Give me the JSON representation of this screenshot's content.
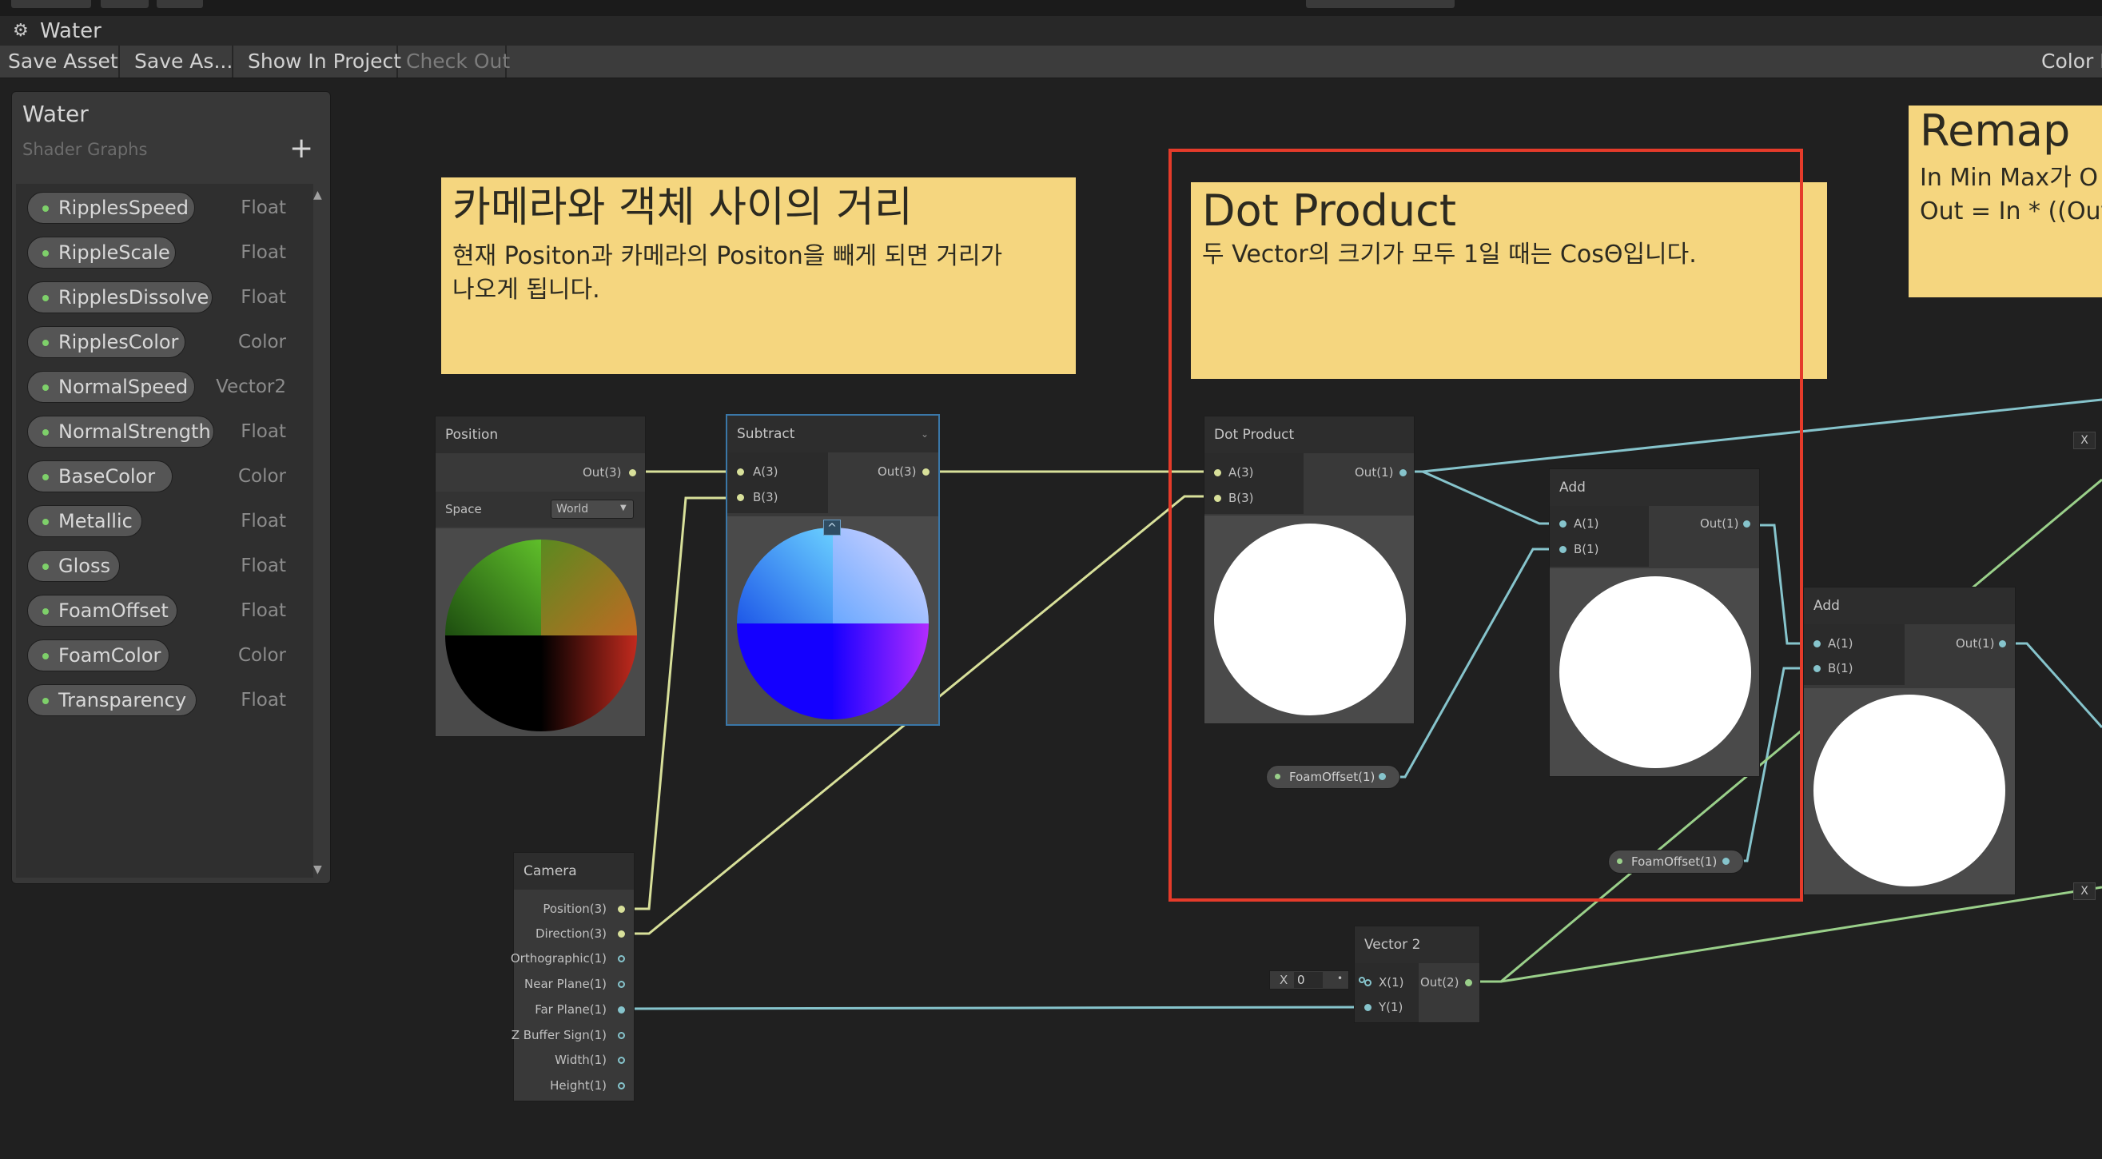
{
  "window": {
    "title": "Water"
  },
  "toolbar": {
    "save_asset": "Save Asset",
    "save_as": "Save As...",
    "show_in_project": "Show In Project",
    "check_out": "Check Out",
    "color_mode": "Color M"
  },
  "blackboard": {
    "title": "Water",
    "subtitle": "Shader Graphs",
    "add": "+",
    "properties": [
      {
        "name": "RipplesSpeed",
        "type": "Float"
      },
      {
        "name": "RippleScale",
        "type": "Float"
      },
      {
        "name": "RipplesDissolve",
        "type": "Float"
      },
      {
        "name": "RipplesColor",
        "type": "Color"
      },
      {
        "name": "NormalSpeed",
        "type": "Vector2"
      },
      {
        "name": "NormalStrength",
        "type": "Float"
      },
      {
        "name": "BaseColor",
        "type": "Color"
      },
      {
        "name": "Metallic",
        "type": "Float"
      },
      {
        "name": "Gloss",
        "type": "Float"
      },
      {
        "name": "FoamOffset",
        "type": "Float"
      },
      {
        "name": "FoamColor",
        "type": "Color"
      },
      {
        "name": "Transparency",
        "type": "Float"
      }
    ]
  },
  "notes": {
    "distance": {
      "title": "카메라와 객체 사이의 거리",
      "body": "현재 Positon과 카메라의 Positon을 빼게 되면 거리가\n나오게 됩니다."
    },
    "dot": {
      "title": "Dot Product",
      "body": "두 Vector의 크기가 모두 1일 때는 CosΘ입니다."
    },
    "remap": {
      "title": "Remap",
      "body": "In Min Max가 O\nOut = In * ((Out"
    }
  },
  "nodes": {
    "position": {
      "title": "Position",
      "out": "Out(3)",
      "space_label": "Space",
      "space_value": "World"
    },
    "subtract": {
      "title": "Subtract",
      "a": "A(3)",
      "b": "B(3)",
      "out": "Out(3)",
      "collapse": "^"
    },
    "dot": {
      "title": "Dot Product",
      "a": "A(3)",
      "b": "B(3)",
      "out": "Out(1)"
    },
    "add1": {
      "title": "Add",
      "a": "A(1)",
      "b": "B(1)",
      "out": "Out(1)"
    },
    "add2": {
      "title": "Add",
      "a": "A(1)",
      "b": "B(1)",
      "out": "Out(1)"
    },
    "camera": {
      "title": "Camera",
      "outputs": [
        "Position(3)",
        "Direction(3)",
        "Orthographic(1)",
        "Near Plane(1)",
        "Far Plane(1)",
        "Z Buffer Sign(1)",
        "Width(1)",
        "Height(1)"
      ]
    },
    "vector2": {
      "title": "Vector 2",
      "x": "X(1)",
      "y": "Y(1)",
      "out": "Out(2)",
      "x_field_label": "X",
      "x_field_value": "0"
    },
    "foam1": {
      "label": "FoamOffset(1)"
    },
    "foam2": {
      "label": "FoamOffset(1)"
    },
    "edge_x1": "X",
    "edge_x2": "X"
  },
  "colors": {
    "vector3_wire": "#d8e09a",
    "vector1_wire": "#86c4cc",
    "vector2_wire": "#9ad08a",
    "sticky": "#f5d67f",
    "highlight": "#e53b2a"
  }
}
